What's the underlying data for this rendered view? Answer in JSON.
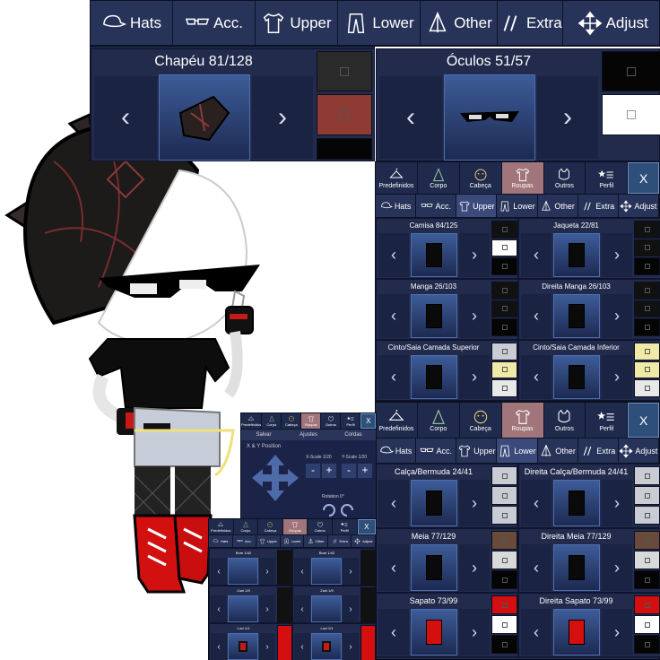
{
  "top_tabs": [
    {
      "label": "Hats",
      "icon": "cap-icon"
    },
    {
      "label": "Acc.",
      "icon": "glasses-icon"
    },
    {
      "label": "Upper",
      "icon": "shirt-icon"
    },
    {
      "label": "Lower",
      "icon": "pants-icon"
    },
    {
      "label": "Other",
      "icon": "sail-icon"
    },
    {
      "label": "Extra",
      "icon": "slash-icon"
    },
    {
      "label": "Adjust",
      "icon": "move-arrows-icon"
    }
  ],
  "hat_slot": {
    "label": "Chapéu 81/128",
    "colors": [
      "#2a2a2a",
      "#8e3b34",
      "#050505"
    ]
  },
  "glasses_slot": {
    "label": "Óculos 51/57",
    "colors": [
      "#050505",
      "#ffffff"
    ]
  },
  "categories": [
    {
      "label": "Predefinidos",
      "icon": "hanger-icon"
    },
    {
      "label": "Corpo",
      "icon": "body-icon"
    },
    {
      "label": "Cabeça",
      "icon": "face-icon"
    },
    {
      "label": "Roupas",
      "icon": "clothes-icon"
    },
    {
      "label": "Outros",
      "icon": "cat-icon"
    },
    {
      "label": "Perfil",
      "icon": "star-list-icon"
    }
  ],
  "close_label": "X",
  "mid_tabs": [
    {
      "label": "Hats",
      "icon": "cap-icon"
    },
    {
      "label": "Acc.",
      "icon": "glasses-icon"
    },
    {
      "label": "Upper",
      "icon": "shirt-icon"
    },
    {
      "label": "Lower",
      "icon": "pants-icon"
    },
    {
      "label": "Other",
      "icon": "sail-icon"
    },
    {
      "label": "Extra",
      "icon": "slash-icon"
    },
    {
      "label": "Adjust",
      "icon": "move-arrows-icon"
    }
  ],
  "upper_slots": [
    {
      "label": "Camisa 84/125",
      "colors": [
        "#111111",
        "#ffffff",
        "#050505"
      ]
    },
    {
      "label": "Jaqueta 22/81",
      "colors": [
        "#111111",
        "#111111",
        "#050505"
      ]
    },
    {
      "label": "Manga 26/103",
      "colors": [
        "#111111",
        "#111111",
        "#050505"
      ]
    },
    {
      "label": "Direita Manga 26/103",
      "colors": [
        "#111111",
        "#111111",
        "#050505"
      ]
    },
    {
      "label": "Cinto/Saia Camada Superior",
      "colors": [
        "#c9ccd2",
        "#f1e9a6",
        "#e8e8e8"
      ]
    },
    {
      "label": "Cinto/Saia Camada Inferior",
      "colors": [
        "#f1e9a6",
        "#f1e9a6",
        "#e8e8e8"
      ]
    }
  ],
  "lower_slots": [
    {
      "label": "Calça/Bermuda 24/41",
      "colors": [
        "#c9ccd2",
        "#c9ccd2",
        "#c9ccd2"
      ]
    },
    {
      "label": "Direita Calça/Bermuda 24/41",
      "colors": [
        "#c9ccd2",
        "#c9ccd2",
        "#c9ccd2"
      ]
    },
    {
      "label": "Meia 77/129",
      "colors": [
        "#6a4a3a",
        "#d9d9d9",
        "#050505"
      ]
    },
    {
      "label": "Direita Meia 77/129",
      "colors": [
        "#6a4a3a",
        "#d9d9d9",
        "#050505"
      ]
    },
    {
      "label": "Sapato 73/99",
      "colors": [
        "#d40f0f",
        "#ffffff",
        "#050505"
      ]
    },
    {
      "label": "Direita Sapato 73/99",
      "colors": [
        "#d40f0f",
        "#ffffff",
        "#050505"
      ]
    }
  ],
  "adjust_panel": {
    "tabs": [
      "Salvar",
      "Ajustes",
      "Cordas"
    ],
    "position_label": "X & Y Position",
    "xscale_label": "X-Scale 1/20",
    "yscale_label": "Y-Scale 1/20",
    "rotation_label": "Rotation 0°",
    "plus": "+",
    "minus": "-"
  },
  "small_panel": {
    "labels": [
      "Bore 1/42",
      "Bore 1/42",
      "Zuni 1/9",
      "Zuni 1/9",
      "Luvi 1/1",
      "Luvi 1/1"
    ]
  },
  "colors": {
    "panel": "#1c2647",
    "tab_bar": "#273358",
    "active_category": "#a2757a",
    "preview_top": "#3d5c98",
    "accent_red": "#d40f0f"
  }
}
